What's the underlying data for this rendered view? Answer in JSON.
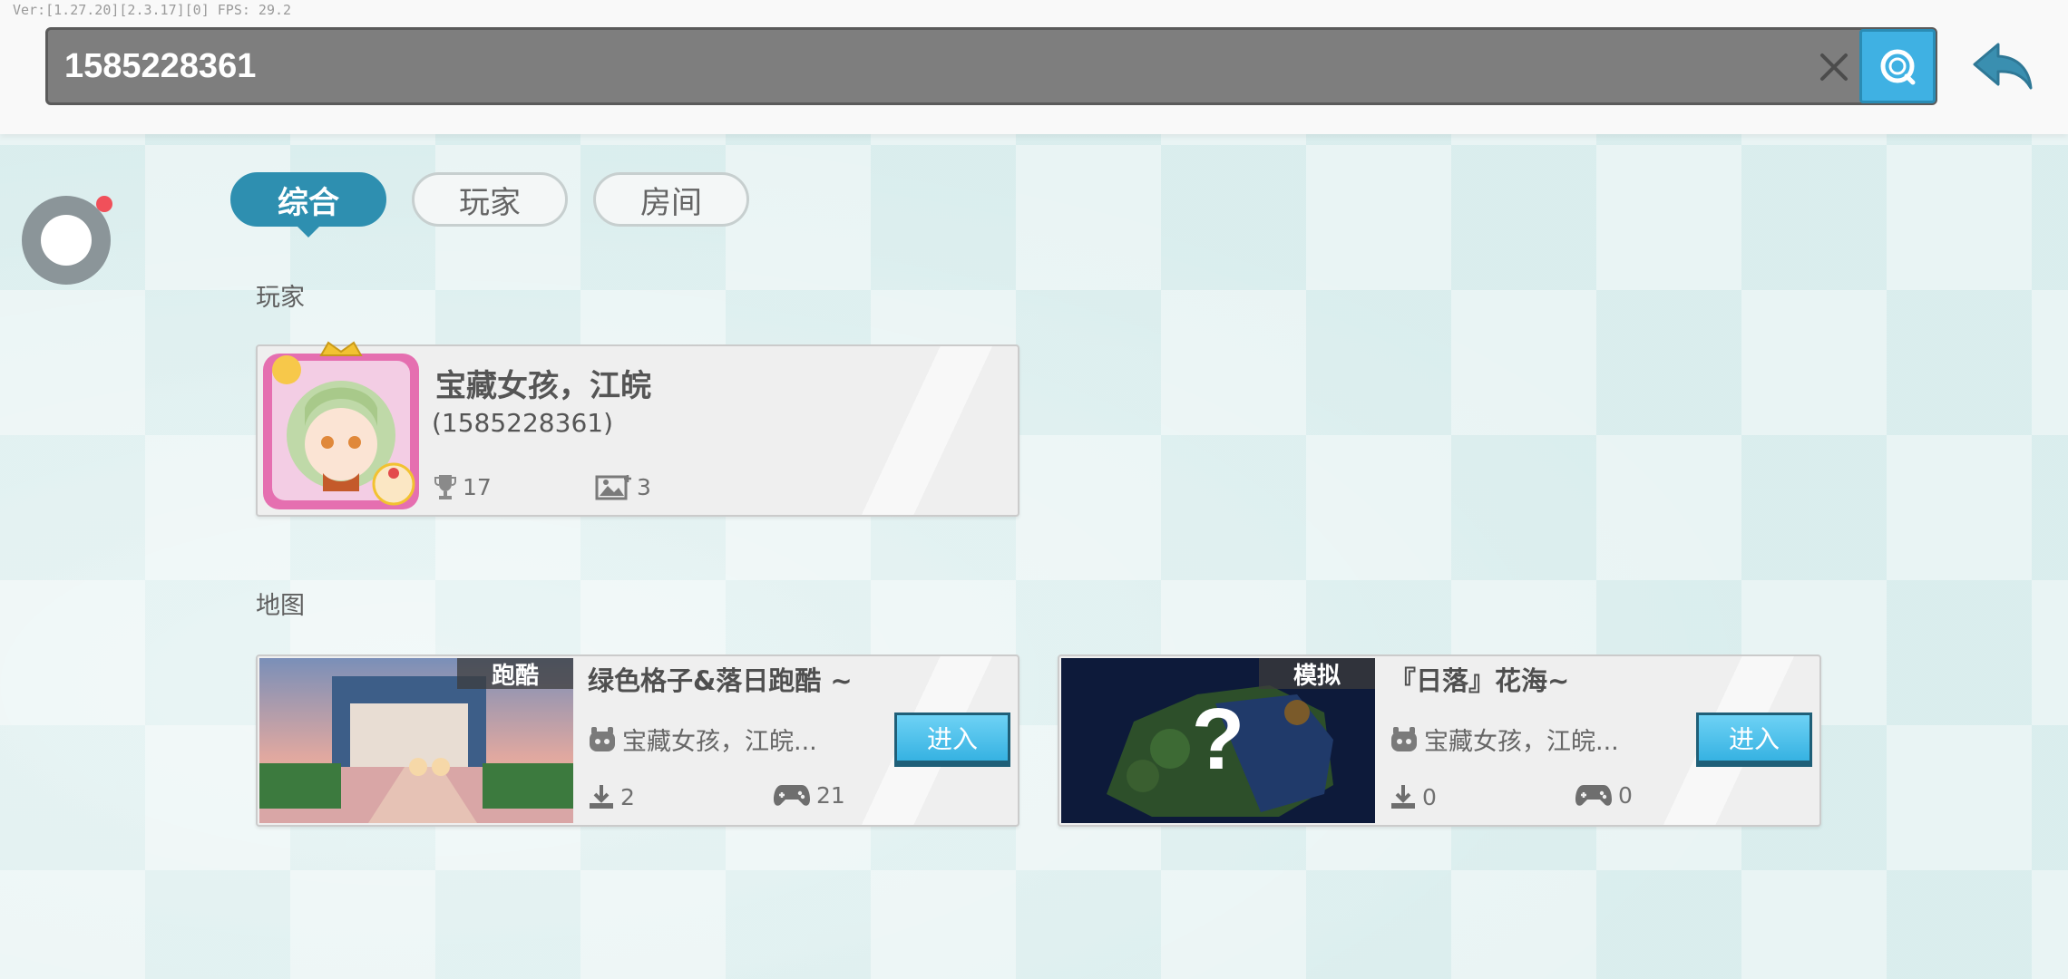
{
  "debug": {
    "text": "Ver:[1.27.20][2.3.17][0] FPS: 29.2"
  },
  "search": {
    "value": "1585228361",
    "clear_icon": "close-icon",
    "search_icon": "search-icon",
    "back_icon": "back-arrow-icon"
  },
  "tabs": [
    {
      "label": "综合",
      "active": true
    },
    {
      "label": "玩家",
      "active": false
    },
    {
      "label": "房间",
      "active": false
    }
  ],
  "sections": {
    "players_label": "玩家",
    "maps_label": "地图"
  },
  "player": {
    "name": "宝藏女孩，江皖",
    "id_text": "(1585228361)",
    "stat_trophy": "17",
    "stat_images": "3"
  },
  "maps": [
    {
      "tag": "跑酷",
      "title": "绿色格子&落日跑酷 ~",
      "author": "宝藏女孩，江皖...",
      "enter_label": "进入",
      "downloads": "2",
      "players": "21"
    },
    {
      "tag": "模拟",
      "title": "『日落』花海~",
      "author": "宝藏女孩，江皖...",
      "enter_label": "进入",
      "downloads": "0",
      "players": "0"
    }
  ],
  "colors": {
    "accent": "#2e8fb0",
    "search_button": "#3fb1e3",
    "enter_button": "#44bdea",
    "notification_dot": "#f0505a"
  }
}
